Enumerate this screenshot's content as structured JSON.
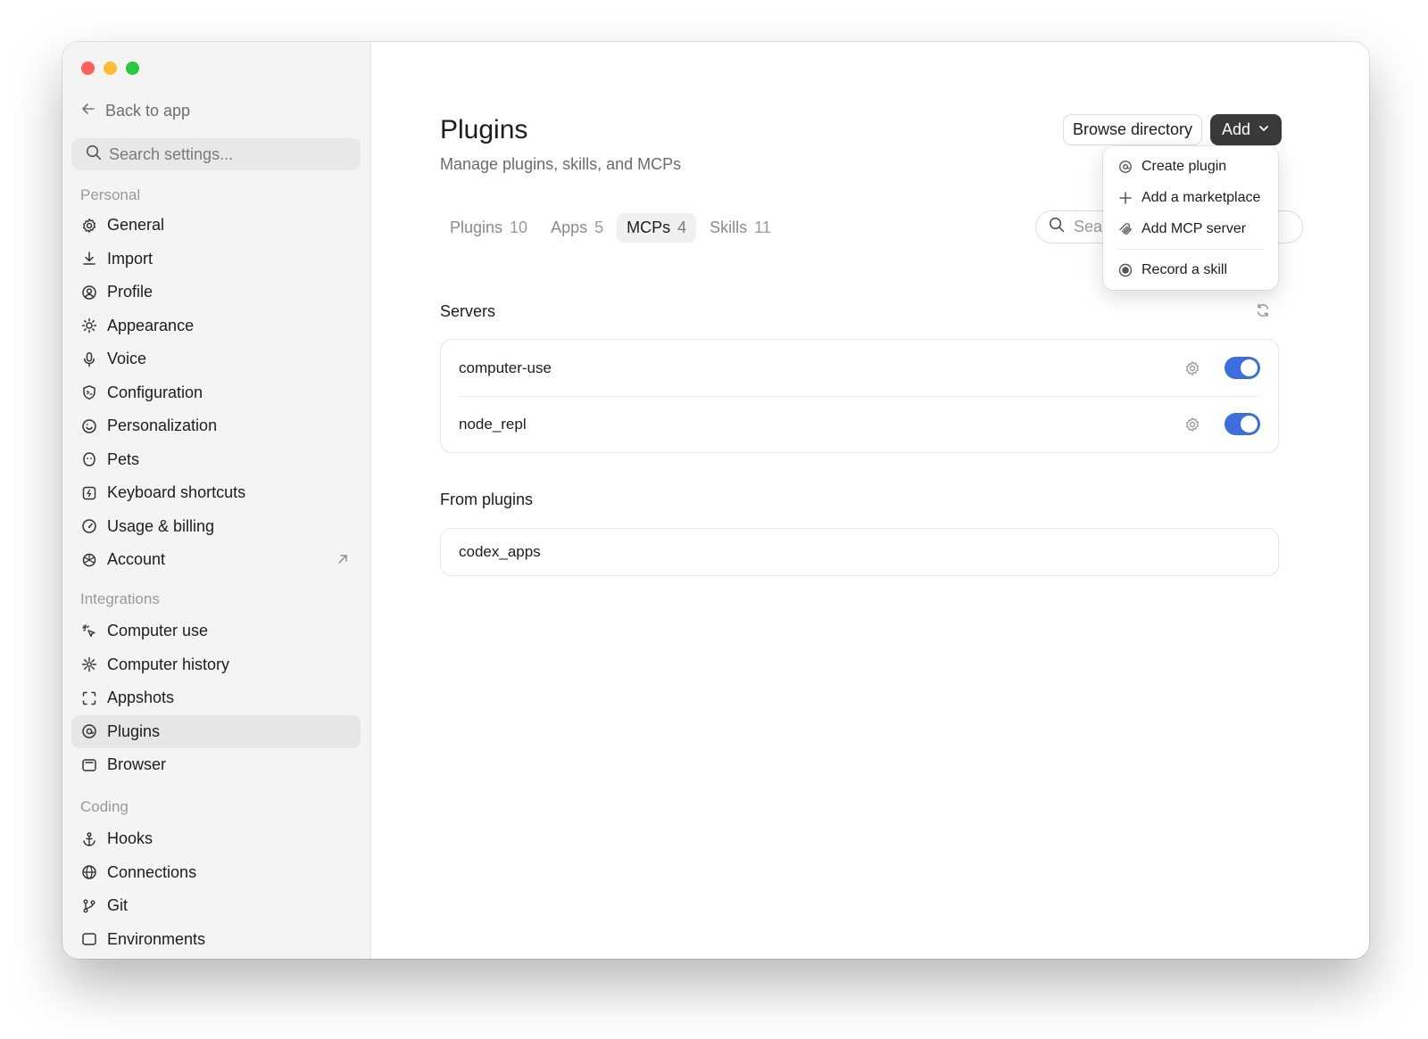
{
  "sidebar": {
    "back_label": "Back to app",
    "search_placeholder": "Search settings...",
    "sections": {
      "personal": "Personal",
      "integrations": "Integrations",
      "coding": "Coding"
    },
    "personal_items": [
      {
        "label": "General",
        "icon": "gear-icon"
      },
      {
        "label": "Import",
        "icon": "download-icon"
      },
      {
        "label": "Profile",
        "icon": "profile-icon"
      },
      {
        "label": "Appearance",
        "icon": "sun-icon"
      },
      {
        "label": "Voice",
        "icon": "microphone-icon"
      },
      {
        "label": "Configuration",
        "icon": "configuration-icon"
      },
      {
        "label": "Personalization",
        "icon": "smiley-icon"
      },
      {
        "label": "Pets",
        "icon": "pet-icon"
      },
      {
        "label": "Keyboard shortcuts",
        "icon": "keyboard-icon"
      },
      {
        "label": "Usage & billing",
        "icon": "gauge-icon"
      },
      {
        "label": "Account",
        "icon": "openai-icon"
      }
    ],
    "integration_items": [
      {
        "label": "Computer use",
        "icon": "cursor-click-icon"
      },
      {
        "label": "Computer history",
        "icon": "sparkle-icon"
      },
      {
        "label": "Appshots",
        "icon": "capture-icon"
      },
      {
        "label": "Plugins",
        "icon": "at-icon"
      },
      {
        "label": "Browser",
        "icon": "browser-icon"
      }
    ],
    "coding_items": [
      {
        "label": "Hooks",
        "icon": "anchor-icon"
      },
      {
        "label": "Connections",
        "icon": "globe-icon"
      },
      {
        "label": "Git",
        "icon": "branch-icon"
      },
      {
        "label": "Environments",
        "icon": "window-icon"
      }
    ]
  },
  "header": {
    "title": "Plugins",
    "subtitle": "Manage plugins, skills, and MCPs",
    "browse_label": "Browse directory",
    "add_label": "Add"
  },
  "tabs": [
    {
      "label": "Plugins",
      "count": "10"
    },
    {
      "label": "Apps",
      "count": "5"
    },
    {
      "label": "MCPs",
      "count": "4"
    },
    {
      "label": "Skills",
      "count": "11"
    }
  ],
  "search": {
    "placeholder": "Search"
  },
  "servers": {
    "title": "Servers",
    "items": [
      {
        "name": "computer-use",
        "enabled": true
      },
      {
        "name": "node_repl",
        "enabled": true
      }
    ]
  },
  "from_plugins": {
    "title": "From plugins",
    "items": [
      {
        "name": "codex_apps"
      }
    ]
  },
  "add_menu": {
    "items": [
      {
        "label": "Create plugin",
        "icon": "at-icon"
      },
      {
        "label": "Add a marketplace",
        "icon": "plus-icon"
      },
      {
        "label": "Add MCP server",
        "icon": "mcp-icon"
      },
      {
        "label": "Record a skill",
        "icon": "record-icon"
      }
    ]
  },
  "colors": {
    "accent": "#3b6fe0",
    "primary_button": "#3a3a3c",
    "close": "#ff5f57",
    "minimize": "#febc2e",
    "zoom": "#28c840"
  }
}
